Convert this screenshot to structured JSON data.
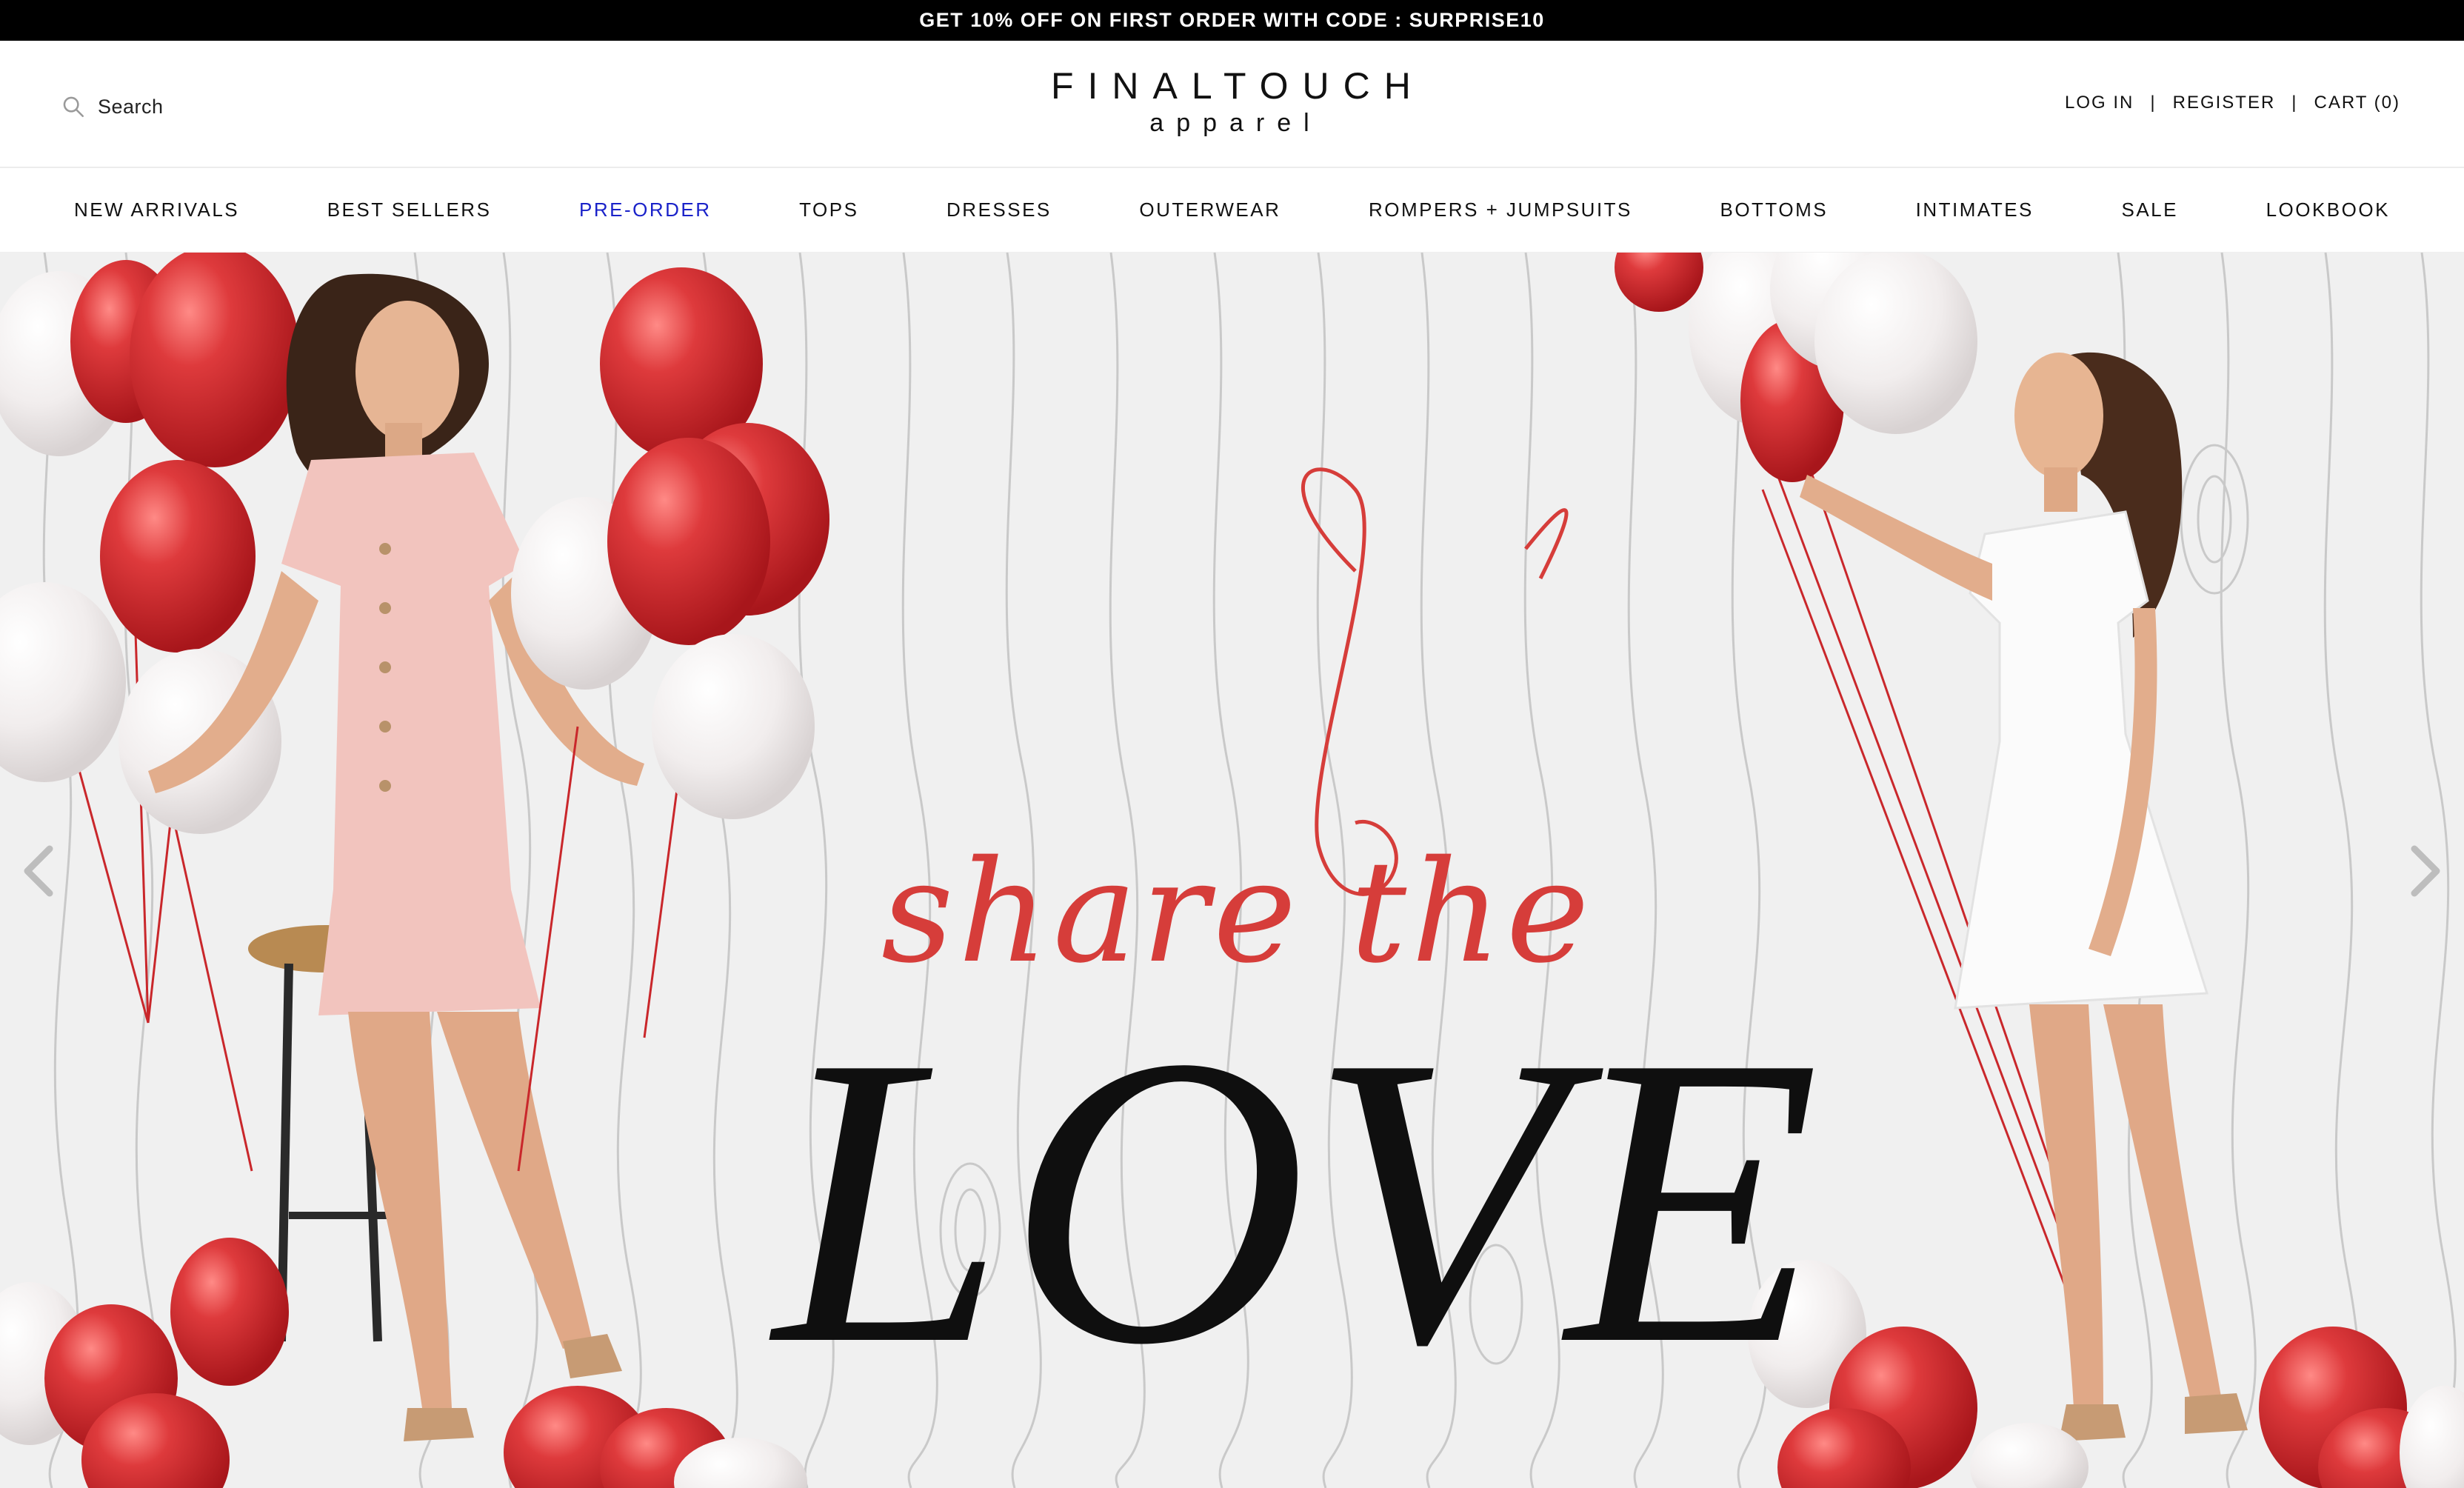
{
  "announcement": {
    "text": "GET 10% OFF ON FIRST ORDER WITH CODE : SURPRISE10"
  },
  "header": {
    "search_label": "Search",
    "search_icon": "search-icon",
    "logo_main": "FINALTOUCH",
    "logo_sub": "apparel",
    "login_label": "LOG IN",
    "register_label": "REGISTER",
    "cart_label": "CART (0)",
    "separator": "|"
  },
  "nav": {
    "items": [
      {
        "label": "NEW ARRIVALS"
      },
      {
        "label": "BEST SELLERS"
      },
      {
        "label": "PRE-ORDER"
      },
      {
        "label": "TOPS"
      },
      {
        "label": "DRESSES"
      },
      {
        "label": "OUTERWEAR"
      },
      {
        "label": "ROMPERS + JUMPSUITS"
      },
      {
        "label": "BOTTOMS"
      },
      {
        "label": "INTIMATES"
      },
      {
        "label": "SALE"
      },
      {
        "label": "LOOKBOOK"
      }
    ],
    "active_color": "#1a22c9"
  },
  "hero": {
    "script_text": "share the",
    "headline": "LOVE",
    "script_color": "#d63d3a",
    "balloon_red": "#d12b2f",
    "balloon_white": "#f4f2f2",
    "prev_icon": "chevron-left-icon",
    "next_icon": "chevron-right-icon"
  }
}
